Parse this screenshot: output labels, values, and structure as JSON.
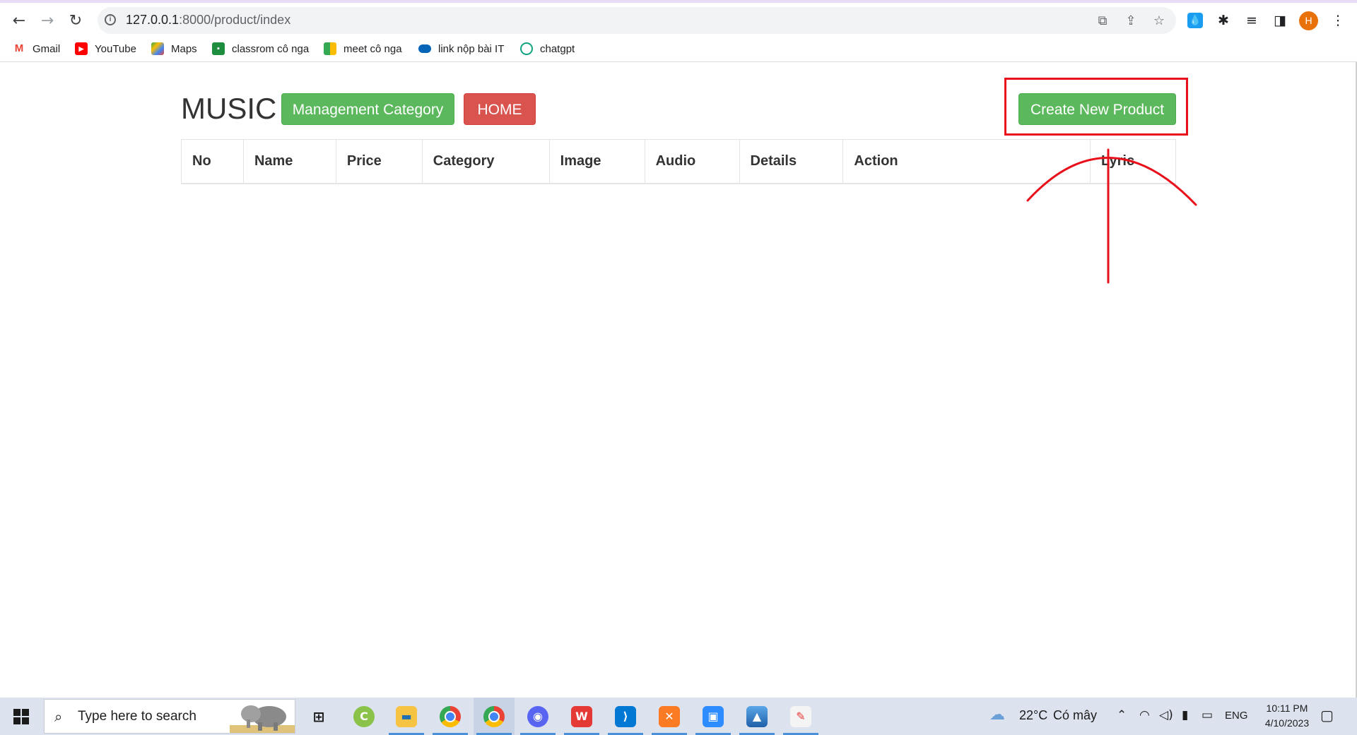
{
  "browser": {
    "url_host": "127.0.0.1",
    "url_path": ":8000/product/index",
    "avatar_letter": "H",
    "bookmarks": [
      {
        "label": "Gmail",
        "icon": "gmail-icon",
        "color": "#ea4335"
      },
      {
        "label": "YouTube",
        "icon": "youtube-icon",
        "color": "#ff0000"
      },
      {
        "label": "Maps",
        "icon": "maps-icon",
        "color": "#34a853"
      },
      {
        "label": "classrom cô nga",
        "icon": "classroom-icon",
        "color": "#1e8e3e"
      },
      {
        "label": "meet cô nga",
        "icon": "meet-icon",
        "color": "#00897b"
      },
      {
        "label": "link nộp bài IT",
        "icon": "onedrive-icon",
        "color": "#0364b8"
      },
      {
        "label": "chatgpt",
        "icon": "chatgpt-icon",
        "color": "#10a37f"
      }
    ]
  },
  "page": {
    "brand": "MUSIC",
    "management_category_label": "Management Category",
    "home_label": "HOME",
    "create_product_label": "Create New Product",
    "table_headers": [
      "No",
      "Name",
      "Price",
      "Category",
      "Image",
      "Audio",
      "Details",
      "Action",
      "Lyric"
    ],
    "colors": {
      "success": "#5cb85c",
      "danger": "#d9534f",
      "annotation": "#e8101a"
    }
  },
  "taskbar": {
    "search_placeholder": "Type here to search",
    "weather_temp": "22°C",
    "weather_desc": "Có mây",
    "language": "ENG",
    "time": "10:11 PM",
    "date": "4/10/2023",
    "apps": [
      "task-view",
      "coccoc",
      "file-explorer",
      "chrome",
      "chrome-profile",
      "discord",
      "wps",
      "vscode",
      "xampp",
      "zoom-or-remote",
      "photos",
      "paint"
    ]
  }
}
